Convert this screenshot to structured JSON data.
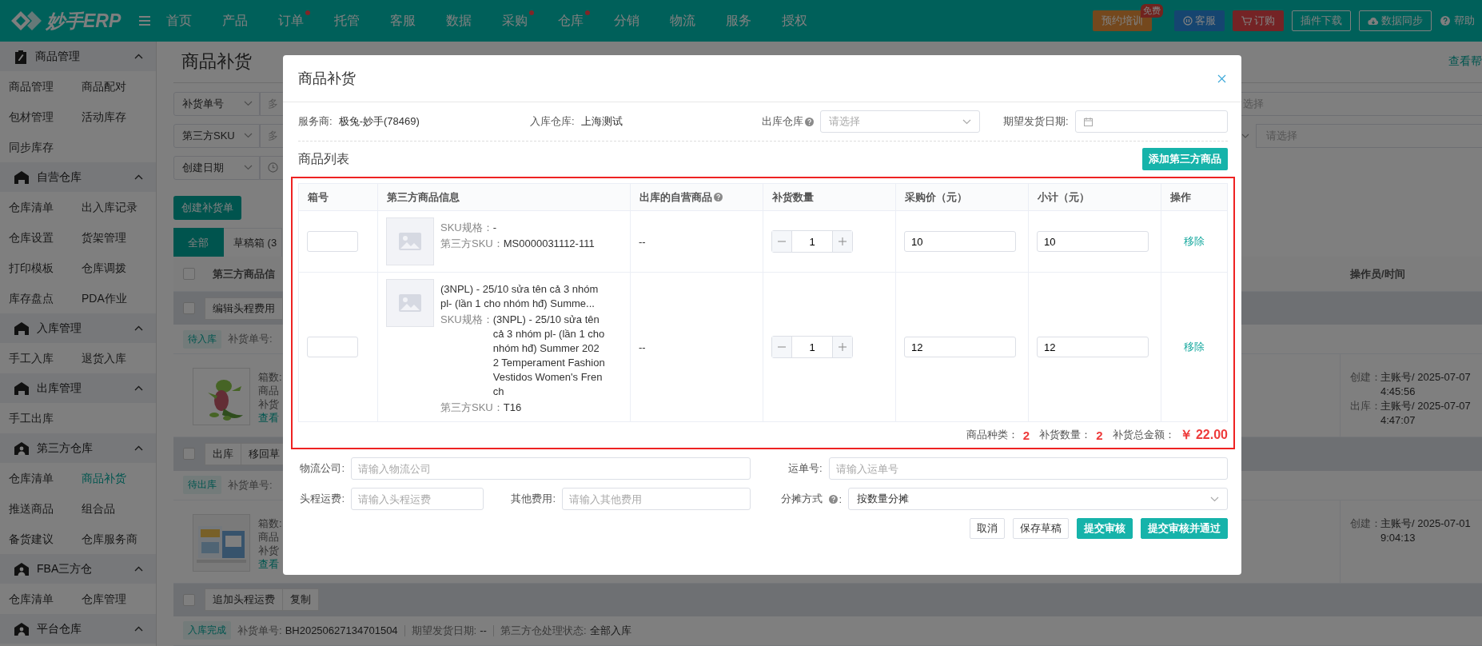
{
  "nav": {
    "logo": "妙手ERP",
    "items": [
      {
        "label": "首页",
        "dot": false
      },
      {
        "label": "产品",
        "dot": false
      },
      {
        "label": "订单",
        "dot": true
      },
      {
        "label": "托管",
        "dot": false
      },
      {
        "label": "客服",
        "dot": false
      },
      {
        "label": "数据",
        "dot": false
      },
      {
        "label": "采购",
        "dot": true
      },
      {
        "label": "仓库",
        "dot": true
      },
      {
        "label": "分销",
        "dot": false
      },
      {
        "label": "物流",
        "dot": false
      },
      {
        "label": "服务",
        "dot": false
      },
      {
        "label": "授权",
        "dot": false
      }
    ],
    "actions": [
      {
        "kind": "training",
        "label": "预约培训",
        "badge": "免费"
      },
      {
        "kind": "service",
        "label": "客服"
      },
      {
        "kind": "order",
        "label": "订购"
      },
      {
        "kind": "plugin",
        "label": "插件下载"
      },
      {
        "kind": "sync",
        "label": "数据同步"
      },
      {
        "kind": "help",
        "label": "帮助"
      }
    ]
  },
  "sidebar": [
    {
      "title": "商品管理",
      "kind": "clipboard",
      "expanded": true,
      "items": [
        {
          "label": "商品管理",
          "selected": false
        },
        {
          "label": "商品配对",
          "selected": false
        },
        {
          "label": "包材管理",
          "selected": false
        },
        {
          "label": "活动库存",
          "selected": false
        },
        {
          "label": "同步库存",
          "selected": false
        }
      ]
    },
    {
      "title": "自营仓库",
      "kind": "house",
      "expanded": true,
      "items": [
        {
          "label": "仓库清单",
          "selected": false
        },
        {
          "label": "出入库记录",
          "selected": false
        },
        {
          "label": "仓库设置",
          "selected": false
        },
        {
          "label": "货架管理",
          "selected": false
        },
        {
          "label": "打印模板",
          "selected": false
        },
        {
          "label": "仓库调拨",
          "selected": false
        },
        {
          "label": "库存盘点",
          "selected": false
        },
        {
          "label": "PDA作业",
          "selected": false
        }
      ]
    },
    {
      "title": "入库管理",
      "kind": "house",
      "expanded": true,
      "items": [
        {
          "label": "手工入库",
          "selected": false
        },
        {
          "label": "退货入库",
          "selected": false
        }
      ]
    },
    {
      "title": "出库管理",
      "kind": "house",
      "expanded": true,
      "items": [
        {
          "label": "手工出库",
          "selected": false
        }
      ]
    },
    {
      "title": "第三方仓库",
      "kind": "person",
      "expanded": true,
      "items": [
        {
          "label": "仓库清单",
          "selected": false
        },
        {
          "label": "商品补货",
          "selected": true
        },
        {
          "label": "推送商品",
          "selected": false
        },
        {
          "label": "组合品",
          "selected": false
        },
        {
          "label": "备货建议",
          "selected": false
        },
        {
          "label": "仓库服务商",
          "selected": false
        }
      ]
    },
    {
      "title": "FBA三方仓",
      "kind": "person",
      "expanded": true,
      "items": [
        {
          "label": "仓库清单",
          "selected": false
        },
        {
          "label": "仓库管理",
          "selected": false
        }
      ]
    },
    {
      "title": "平台仓库",
      "kind": "person",
      "expanded": true
    }
  ],
  "page": {
    "title": "商品补货",
    "help_link": "查看帮",
    "filters": [
      {
        "field": "补货单号",
        "kind": "text",
        "placeholder": "多"
      },
      {
        "field": "第三方SKU",
        "kind": "text",
        "placeholder": "多"
      },
      {
        "field": "创建日期",
        "kind": "date"
      }
    ],
    "right_filters": [
      {
        "placeholder": "选择"
      },
      {
        "placeholder": "请选择"
      }
    ],
    "create_button": "创建补货单",
    "tabs": [
      {
        "label": "全部",
        "selected": true
      },
      {
        "label": "草稿箱 (3",
        "selected": false
      }
    ],
    "columns": [
      "第三方商品信",
      "操作员/时间"
    ],
    "all_checked": false,
    "groups": [
      {
        "actions": [
          "编辑头程费用"
        ],
        "checked": false,
        "status": "待入库",
        "order_label": "补货单号:",
        "info": [
          "箱数:",
          "商品",
          "补货"
        ],
        "link": "查看",
        "operator": [
          {
            "label": "创建：",
            "value": "主账号/ 2025-07-07\n4:45:56"
          },
          {
            "label": "出库：",
            "value": "主账号/ 2025-07-07\n4:47:07"
          }
        ]
      },
      {
        "actions": [
          "出库",
          "移回草"
        ],
        "checked": false,
        "status": "待出库",
        "order_label": "补货单号:",
        "info": [
          "箱数:",
          "商品",
          "补货"
        ],
        "link": "查看",
        "operator": [
          {
            "label": "创建：",
            "value": "主账号/ 2025-07-01\n9:04:13"
          }
        ]
      }
    ],
    "last_group": {
      "actions": [
        "追加头程运费",
        "复制"
      ],
      "checked": false,
      "status": "入库完成",
      "fields": [
        {
          "label": "补货单号:",
          "value": "BH20250627134701504"
        },
        {
          "label": "期望发货日期:",
          "value": "--"
        },
        {
          "label": "第三方仓处理状态:",
          "value": "全部入库"
        }
      ]
    }
  },
  "dialog": {
    "title": "商品补货",
    "info": [
      {
        "label": "服务商:",
        "value": "极兔-妙手(78469)"
      },
      {
        "label": "入库仓库:",
        "value": "上海测试"
      }
    ],
    "outbound": {
      "label": "出库仓库",
      "placeholder": "请选择"
    },
    "date_label": "期望发货日期:",
    "list_title": "商品列表",
    "add_button": "添加第三方商品",
    "columns": [
      "箱号",
      "第三方商品信息",
      "出库的自营商品",
      "补货数量",
      "采购价（元）",
      "小计（元）",
      "操作"
    ],
    "rows": [
      {
        "spec_label": "SKU规格：",
        "spec": "-",
        "sku_label": "第三方SKU：",
        "sku": "MS0000031112-111",
        "own": "--",
        "qty": "1",
        "price": "10",
        "subtotal": "10",
        "action": "移除"
      },
      {
        "name": "(3NPL) - 25/10 sửa tên cả 3 nhóm pl- (lần 1 cho nhóm hđ) Summe...",
        "spec_label": "SKU规格：",
        "spec": "(3NPL) - 25/10 sửa tên cả 3 nhóm pl- (lần 1 cho nhóm hđ) Summer 2022 Temperament Fashion Vestidos Women's French",
        "sku_label": "第三方SKU：",
        "sku": "T16",
        "own": "--",
        "qty": "1",
        "price": "12",
        "subtotal": "12",
        "action": "移除"
      }
    ],
    "summary": [
      {
        "label": "商品种类：",
        "value": "2"
      },
      {
        "label": "补货数量：",
        "value": "2"
      },
      {
        "label": "补货总金额：",
        "value": "￥ 22.00"
      }
    ],
    "form": {
      "logistics": {
        "label": "物流公司:",
        "placeholder": "请输入物流公司"
      },
      "waybill": {
        "label": "运单号:",
        "placeholder": "请输入运单号"
      },
      "freight": {
        "label": "头程运费:",
        "placeholder": "请输入头程运费"
      },
      "other": {
        "label": "其他费用:",
        "placeholder": "请输入其他费用"
      },
      "split": {
        "label": "分摊方式",
        "suffix": ":",
        "value": "按数量分摊"
      }
    },
    "buttons": [
      {
        "kind": "plain",
        "label": "取消"
      },
      {
        "kind": "plain",
        "label": "保存草稿"
      },
      {
        "kind": "primary",
        "label": "提交审核"
      },
      {
        "kind": "primary",
        "label": "提交审核并通过"
      }
    ]
  }
}
